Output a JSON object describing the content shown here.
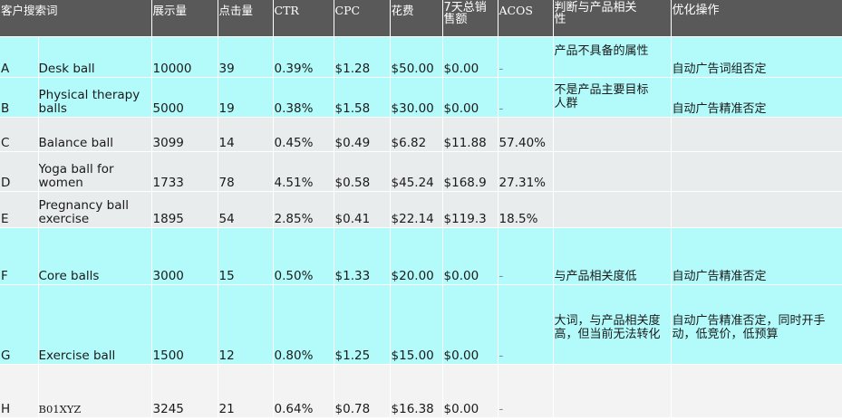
{
  "headers": {
    "keyword": "客户搜索词",
    "impressions": "展示量",
    "clicks": "点击量",
    "ctr": "CTR",
    "cpc": "CPC",
    "spend": "花费",
    "sales_7d": "7天总销售额",
    "acos": "ACOS",
    "relevance": "判断与产品相关性",
    "action": "优化操作"
  },
  "rows": [
    {
      "id": "A",
      "keyword": "Desk ball",
      "impressions": "10000",
      "clicks": "39",
      "ctr": "0.39%",
      "cpc": "$1.28",
      "spend": "$50.00",
      "sales": "$0.00",
      "acos": "-",
      "relevance": "产品不具备的属性",
      "action": "自动广告词组否定"
    },
    {
      "id": "B",
      "keyword": "Physical therapy balls",
      "impressions": "5000",
      "clicks": "19",
      "ctr": "0.38%",
      "cpc": "$1.58",
      "spend": "$30.00",
      "sales": "$0.00",
      "acos": "-",
      "relevance": "不是产品主要目标人群",
      "action": "自动广告精准否定"
    },
    {
      "id": "C",
      "keyword": "Balance ball",
      "impressions": "3099",
      "clicks": "14",
      "ctr": "0.45%",
      "cpc": "$0.49",
      "spend": "$6.82",
      "sales": "$11.88",
      "acos": "57.40%",
      "relevance": "",
      "action": ""
    },
    {
      "id": "D",
      "keyword": "Yoga ball for women",
      "impressions": "1733",
      "clicks": "78",
      "ctr": "4.51%",
      "cpc": "$0.58",
      "spend": "$45.24",
      "sales": "$168.9",
      "acos": "27.31%",
      "relevance": "",
      "action": ""
    },
    {
      "id": "E",
      "keyword": "Pregnancy ball exercise",
      "impressions": "1895",
      "clicks": "54",
      "ctr": "2.85%",
      "cpc": "$0.41",
      "spend": "$22.14",
      "sales": "$119.3",
      "acos": "18.5%",
      "relevance": "",
      "action": ""
    },
    {
      "id": "F",
      "keyword": "Core balls",
      "impressions": "3000",
      "clicks": "15",
      "ctr": "0.50%",
      "cpc": "$1.33",
      "spend": "$20.00",
      "sales": "$0.00",
      "acos": "-",
      "relevance": "与产品相关度低",
      "action": "自动广告精准否定"
    },
    {
      "id": "G",
      "keyword": "Exercise ball",
      "impressions": "1500",
      "clicks": "12",
      "ctr": "0.80%",
      "cpc": "$1.25",
      "spend": "$15.00",
      "sales": "$0.00",
      "acos": "-",
      "relevance": "大词，与产品相关度高，但当前无法转化",
      "action": "自动广告精准否定，同时开手动，低竞价，低预算"
    },
    {
      "id": "H",
      "keyword": "B01XYZ",
      "impressions": "3245",
      "clicks": "21",
      "ctr": "0.64%",
      "cpc": "$0.78",
      "spend": "$16.38",
      "sales": "$0.00",
      "acos": "-",
      "relevance": "",
      "action": ""
    }
  ],
  "colors": {
    "header_bg": "#595959",
    "cyan_row": "#b3fbfb",
    "grey_row": "#e9ecec"
  }
}
